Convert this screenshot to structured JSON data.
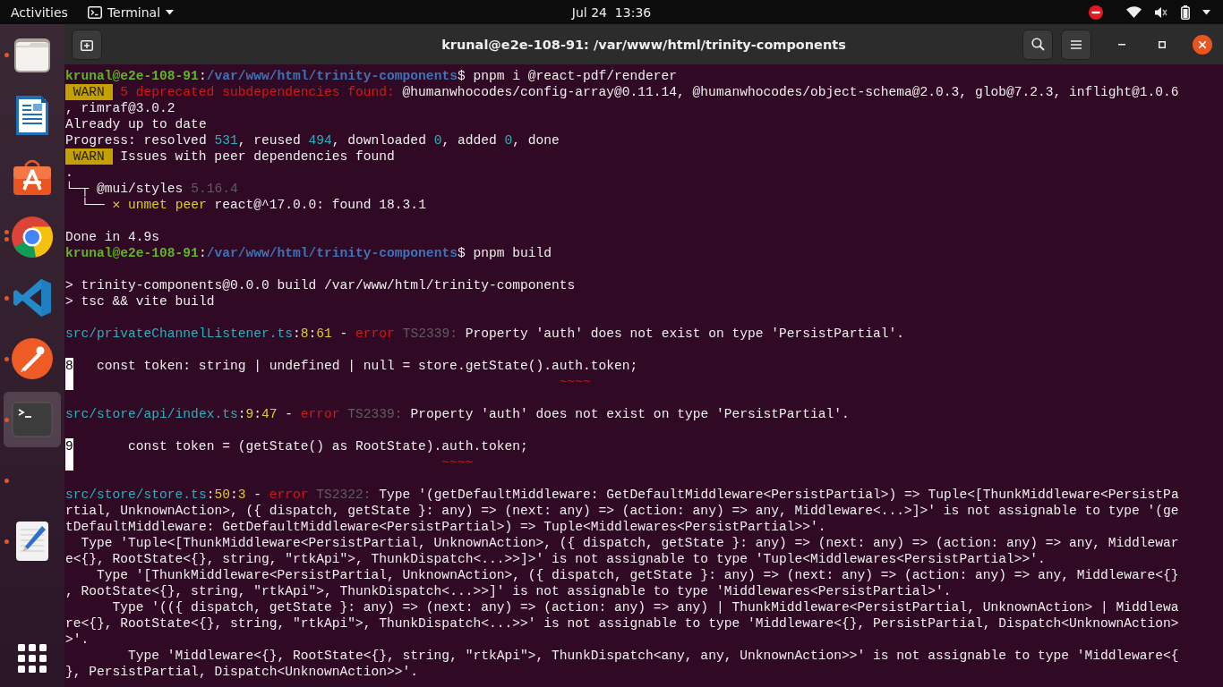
{
  "top_bar": {
    "activities": "Activities",
    "app_menu": "Terminal",
    "clock": "Jul 24  13:36"
  },
  "dock": {
    "items": [
      {
        "kind": "files",
        "running": true,
        "multiple": false,
        "selected": false
      },
      {
        "kind": "writer",
        "running": false,
        "multiple": false,
        "selected": false
      },
      {
        "kind": "store",
        "running": false,
        "multiple": false,
        "selected": false
      },
      {
        "kind": "chrome",
        "running": true,
        "multiple": true,
        "selected": false
      },
      {
        "kind": "vscode",
        "running": true,
        "multiple": false,
        "selected": false
      },
      {
        "kind": "postman",
        "running": true,
        "multiple": false,
        "selected": false
      },
      {
        "kind": "terminal",
        "running": true,
        "multiple": false,
        "selected": true
      },
      {
        "kind": "blank",
        "running": true,
        "multiple": false,
        "selected": false
      },
      {
        "kind": "editor",
        "running": true,
        "multiple": false,
        "selected": false
      }
    ]
  },
  "window": {
    "title": "krunal@e2e-108-91: /var/www/html/trinity-components"
  },
  "terminal": {
    "lines": [
      {
        "kind": "text",
        "segments": [
          {
            "kind": "user",
            "text": "krunal@e2e-108-91"
          },
          {
            "kind": "plain",
            "text": ":"
          },
          {
            "kind": "path",
            "text": "/var/www/html/trinity-components"
          },
          {
            "kind": "plain",
            "text": "$ pnpm i @react-pdf/renderer"
          }
        ]
      },
      {
        "kind": "text",
        "badge": "WARN",
        "segments": [
          {
            "kind": "red",
            "text": "5 deprecated subdependencies found:"
          },
          {
            "kind": "plain",
            "text": " @humanwhocodes/config-array@0.11.14, @humanwhocodes/object-schema@2.0.3, glob@7.2.3, inflight@1.0.6"
          }
        ]
      },
      {
        "kind": "text",
        "segments": [
          {
            "kind": "plain",
            "text": ", rimraf@3.0.2"
          }
        ]
      },
      {
        "kind": "text",
        "segments": [
          {
            "kind": "plain",
            "text": "Already up to date"
          }
        ]
      },
      {
        "kind": "text",
        "segments": [
          {
            "kind": "plain",
            "text": "Progress: resolved "
          },
          {
            "kind": "cyan",
            "text": "531"
          },
          {
            "kind": "plain",
            "text": ", reused "
          },
          {
            "kind": "cyan",
            "text": "494"
          },
          {
            "kind": "plain",
            "text": ", downloaded "
          },
          {
            "kind": "cyan",
            "text": "0"
          },
          {
            "kind": "plain",
            "text": ", added "
          },
          {
            "kind": "cyan",
            "text": "0"
          },
          {
            "kind": "plain",
            "text": ", done"
          }
        ]
      },
      {
        "kind": "text",
        "badge": "WARN",
        "segments": [
          {
            "kind": "plain",
            "text": "Issues with peer dependencies found"
          }
        ]
      },
      {
        "kind": "text",
        "segments": [
          {
            "kind": "plain",
            "text": "."
          }
        ]
      },
      {
        "kind": "text",
        "segments": [
          {
            "kind": "plain",
            "text": "└─┬ @mui/styles "
          },
          {
            "kind": "dim",
            "text": "5.16.4"
          }
        ]
      },
      {
        "kind": "text",
        "segments": [
          {
            "kind": "plain",
            "text": "  └── "
          },
          {
            "kind": "yellow",
            "text": "✕ unmet peer"
          },
          {
            "kind": "plain",
            "text": " react@^17.0.0: found 18.3.1"
          }
        ]
      },
      {
        "kind": "blank"
      },
      {
        "kind": "text",
        "segments": [
          {
            "kind": "plain",
            "text": "Done in 4.9s"
          }
        ]
      },
      {
        "kind": "text",
        "segments": [
          {
            "kind": "user",
            "text": "krunal@e2e-108-91"
          },
          {
            "kind": "plain",
            "text": ":"
          },
          {
            "kind": "path",
            "text": "/var/www/html/trinity-components"
          },
          {
            "kind": "plain",
            "text": "$ pnpm build"
          }
        ]
      },
      {
        "kind": "blank"
      },
      {
        "kind": "text",
        "segments": [
          {
            "kind": "plain",
            "text": "> trinity-components@0.0.0 build /var/www/html/trinity-components"
          }
        ]
      },
      {
        "kind": "text",
        "segments": [
          {
            "kind": "plain",
            "text": "> tsc && vite build"
          }
        ]
      },
      {
        "kind": "blank"
      },
      {
        "kind": "text",
        "segments": [
          {
            "kind": "cyan",
            "text": "src/privateChannelListener.ts"
          },
          {
            "kind": "plain",
            "text": ":"
          },
          {
            "kind": "yellow",
            "text": "8"
          },
          {
            "kind": "plain",
            "text": ":"
          },
          {
            "kind": "yellow",
            "text": "61"
          },
          {
            "kind": "plain",
            "text": " - "
          },
          {
            "kind": "red",
            "text": "error"
          },
          {
            "kind": "dim",
            "text": " TS2339:"
          },
          {
            "kind": "plain",
            "text": " Property 'auth' does not exist on type 'PersistPartial'."
          }
        ]
      },
      {
        "kind": "blank"
      },
      {
        "kind": "text",
        "gutter": "8",
        "segments": [
          {
            "kind": "plain",
            "text": "   const token: string | undefined | null = store.getState().auth.token;"
          }
        ]
      },
      {
        "kind": "text",
        "gutter_marker": true,
        "segments": [
          {
            "kind": "red",
            "text": "                                                              ~~~~"
          }
        ]
      },
      {
        "kind": "blank"
      },
      {
        "kind": "text",
        "segments": [
          {
            "kind": "cyan",
            "text": "src/store/api/index.ts"
          },
          {
            "kind": "plain",
            "text": ":"
          },
          {
            "kind": "yellow",
            "text": "9"
          },
          {
            "kind": "plain",
            "text": ":"
          },
          {
            "kind": "yellow",
            "text": "47"
          },
          {
            "kind": "plain",
            "text": " - "
          },
          {
            "kind": "red",
            "text": "error"
          },
          {
            "kind": "dim",
            "text": " TS2339:"
          },
          {
            "kind": "plain",
            "text": " Property 'auth' does not exist on type 'PersistPartial'."
          }
        ]
      },
      {
        "kind": "blank"
      },
      {
        "kind": "text",
        "gutter": "9",
        "segments": [
          {
            "kind": "plain",
            "text": "       const token = (getState() as RootState).auth.token;"
          }
        ]
      },
      {
        "kind": "text",
        "gutter_marker": true,
        "segments": [
          {
            "kind": "red",
            "text": "                                               ~~~~"
          }
        ]
      },
      {
        "kind": "blank"
      },
      {
        "kind": "text",
        "segments": [
          {
            "kind": "cyan",
            "text": "src/store/store.ts"
          },
          {
            "kind": "plain",
            "text": ":"
          },
          {
            "kind": "yellow",
            "text": "50"
          },
          {
            "kind": "plain",
            "text": ":"
          },
          {
            "kind": "yellow",
            "text": "3"
          },
          {
            "kind": "plain",
            "text": " - "
          },
          {
            "kind": "red",
            "text": "error"
          },
          {
            "kind": "dim",
            "text": " TS2322:"
          },
          {
            "kind": "plain",
            "text": " Type '(getDefaultMiddleware: GetDefaultMiddleware<PersistPartial>) => Tuple<[ThunkMiddleware<PersistPa"
          }
        ]
      },
      {
        "kind": "text",
        "segments": [
          {
            "kind": "plain",
            "text": "rtial, UnknownAction>, ({ dispatch, getState }: any) => (next: any) => (action: any) => any, Middleware<...>]>' is not assignable to type '(ge"
          }
        ]
      },
      {
        "kind": "text",
        "segments": [
          {
            "kind": "plain",
            "text": "tDefaultMiddleware: GetDefaultMiddleware<PersistPartial>) => Tuple<Middlewares<PersistPartial>>'."
          }
        ]
      },
      {
        "kind": "text",
        "segments": [
          {
            "kind": "plain",
            "text": "  Type 'Tuple<[ThunkMiddleware<PersistPartial, UnknownAction>, ({ dispatch, getState }: any) => (next: any) => (action: any) => any, Middlewar"
          }
        ]
      },
      {
        "kind": "text",
        "segments": [
          {
            "kind": "plain",
            "text": "e<{}, RootState<{}, string, \"rtkApi\">, ThunkDispatch<...>>]>' is not assignable to type 'Tuple<Middlewares<PersistPartial>>'."
          }
        ]
      },
      {
        "kind": "text",
        "segments": [
          {
            "kind": "plain",
            "text": "    Type '[ThunkMiddleware<PersistPartial, UnknownAction>, ({ dispatch, getState }: any) => (next: any) => (action: any) => any, Middleware<{}"
          }
        ]
      },
      {
        "kind": "text",
        "segments": [
          {
            "kind": "plain",
            "text": ", RootState<{}, string, \"rtkApi\">, ThunkDispatch<...>>]' is not assignable to type 'Middlewares<PersistPartial>'."
          }
        ]
      },
      {
        "kind": "text",
        "segments": [
          {
            "kind": "plain",
            "text": "      Type '(({ dispatch, getState }: any) => (next: any) => (action: any) => any) | ThunkMiddleware<PersistPartial, UnknownAction> | Middlewa"
          }
        ]
      },
      {
        "kind": "text",
        "segments": [
          {
            "kind": "plain",
            "text": "re<{}, RootState<{}, string, \"rtkApi\">, ThunkDispatch<...>>' is not assignable to type 'Middleware<{}, PersistPartial, Dispatch<UnknownAction>"
          }
        ]
      },
      {
        "kind": "text",
        "segments": [
          {
            "kind": "plain",
            "text": ">'."
          }
        ]
      },
      {
        "kind": "text",
        "segments": [
          {
            "kind": "plain",
            "text": "        Type 'Middleware<{}, RootState<{}, string, \"rtkApi\">, ThunkDispatch<any, any, UnknownAction>>' is not assignable to type 'Middleware<{"
          }
        ]
      },
      {
        "kind": "text",
        "segments": [
          {
            "kind": "plain",
            "text": "}, PersistPartial, Dispatch<UnknownAction>>'."
          }
        ]
      }
    ]
  }
}
